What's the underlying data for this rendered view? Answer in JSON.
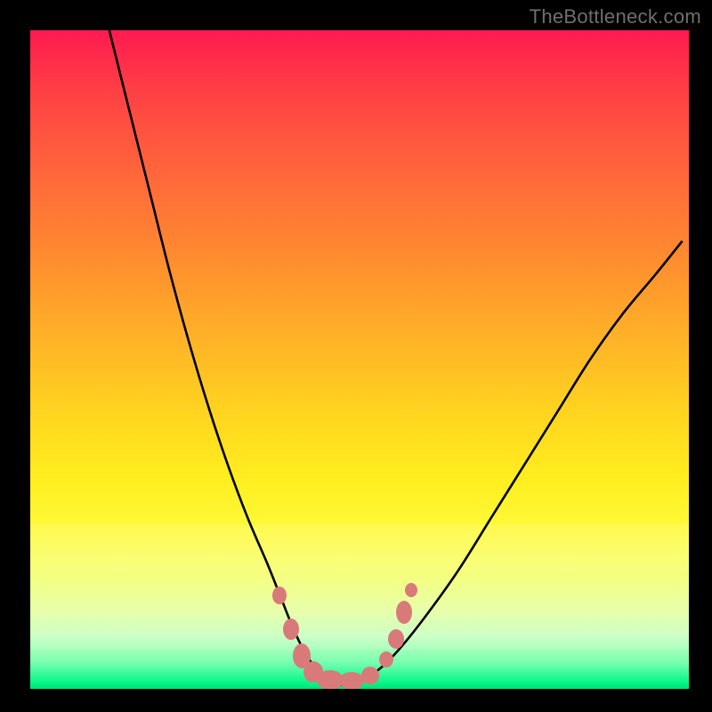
{
  "watermark": "TheBottleneck.com",
  "chart_data": {
    "type": "line",
    "title": "",
    "xlabel": "",
    "ylabel": "",
    "xlim": [
      0,
      100
    ],
    "ylim": [
      0,
      100
    ],
    "series": [
      {
        "name": "curve",
        "x": [
          12,
          15,
          18,
          21,
          24,
          27,
          30,
          33,
          36,
          38,
          40,
          42,
          44,
          46,
          48,
          50,
          53,
          56,
          60,
          65,
          70,
          75,
          80,
          85,
          90,
          95,
          99
        ],
        "values": [
          100,
          88,
          76,
          64,
          53,
          43,
          34,
          26,
          19,
          14,
          9,
          5,
          2.5,
          1,
          0.5,
          1,
          3,
          6,
          11,
          18,
          26,
          34,
          42,
          50,
          57,
          63,
          68
        ]
      }
    ],
    "highlight_points": [
      {
        "x_ratio": 0.378,
        "y_ratio": 0.858,
        "w": 16,
        "h": 20
      },
      {
        "x_ratio": 0.396,
        "y_ratio": 0.91,
        "w": 18,
        "h": 24
      },
      {
        "x_ratio": 0.412,
        "y_ratio": 0.95,
        "w": 20,
        "h": 28
      },
      {
        "x_ratio": 0.43,
        "y_ratio": 0.974,
        "w": 22,
        "h": 24
      },
      {
        "x_ratio": 0.456,
        "y_ratio": 0.986,
        "w": 30,
        "h": 22
      },
      {
        "x_ratio": 0.488,
        "y_ratio": 0.988,
        "w": 28,
        "h": 20
      },
      {
        "x_ratio": 0.516,
        "y_ratio": 0.98,
        "w": 20,
        "h": 20
      },
      {
        "x_ratio": 0.54,
        "y_ratio": 0.956,
        "w": 16,
        "h": 18
      },
      {
        "x_ratio": 0.556,
        "y_ratio": 0.924,
        "w": 18,
        "h": 22
      },
      {
        "x_ratio": 0.568,
        "y_ratio": 0.884,
        "w": 18,
        "h": 26
      },
      {
        "x_ratio": 0.578,
        "y_ratio": 0.85,
        "w": 14,
        "h": 16
      }
    ],
    "colors": {
      "curve": "#000000",
      "highlight": "#d97a7a"
    }
  }
}
